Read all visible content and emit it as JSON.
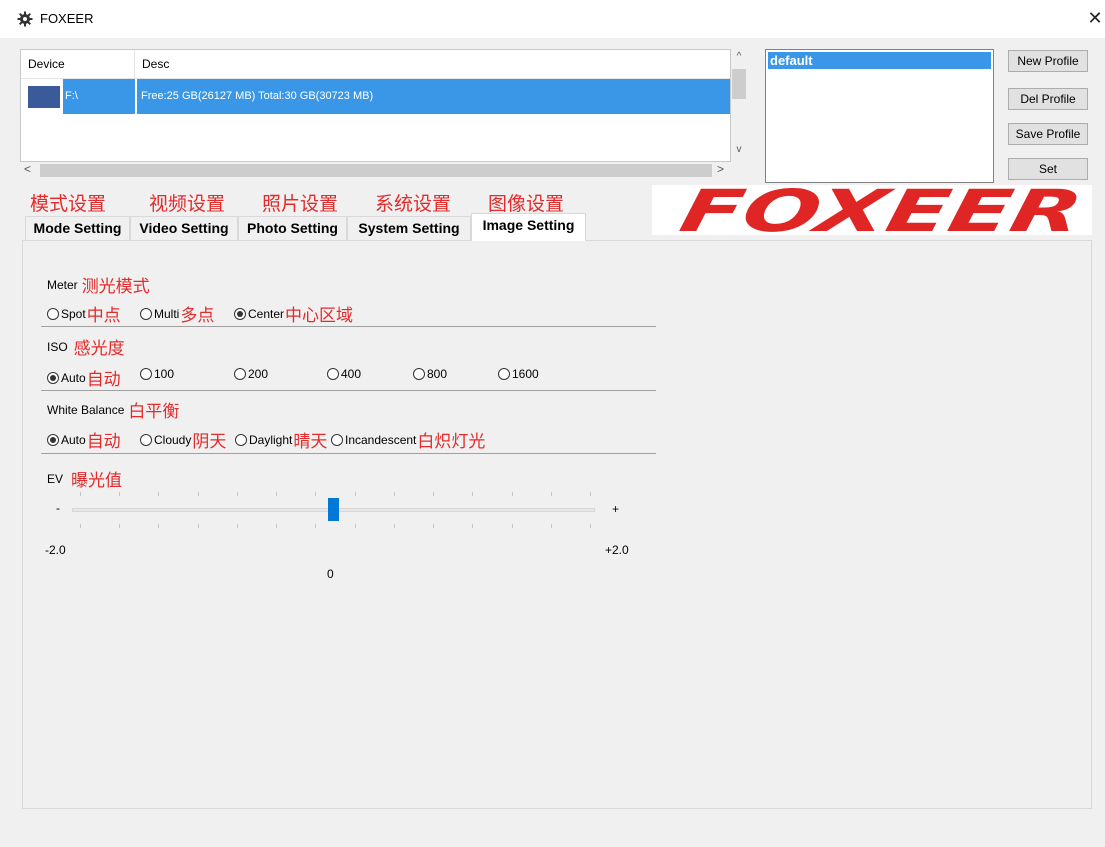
{
  "window": {
    "title": "FOXEER",
    "close_glyph": "✕"
  },
  "device_list": {
    "columns": [
      "Device",
      "Desc"
    ],
    "rows": [
      {
        "device": "F:\\",
        "desc": "Free:25 GB(26127 MB) Total:30 GB(30723 MB)",
        "selected": true
      }
    ]
  },
  "scroll_glyphs": {
    "up": "^",
    "down": "v",
    "left": "<",
    "right": ">"
  },
  "profiles": {
    "items": [
      "default"
    ],
    "selected": "default"
  },
  "buttons": {
    "new": "New Profile",
    "del": "Del Profile",
    "save": "Save Profile",
    "set": "Set"
  },
  "tabs_cn": [
    "模式设置",
    "视频设置",
    "照片设置",
    "系统设置",
    "图像设置"
  ],
  "tabs": [
    "Mode Setting",
    "Video Setting",
    "Photo Setting",
    "System Setting",
    "Image Setting"
  ],
  "active_tab": "Image Setting",
  "logo_text": "FOXEER",
  "image_setting": {
    "meter": {
      "label": "Meter",
      "label_cn": "测光模式",
      "options": [
        {
          "en": "Spot",
          "cn": "中点",
          "selected": false
        },
        {
          "en": "Multi",
          "cn": "多点",
          "selected": false
        },
        {
          "en": "Center",
          "cn": "中心区域",
          "selected": true
        }
      ]
    },
    "iso": {
      "label": "ISO",
      "label_cn": "感光度",
      "options": [
        {
          "en": "Auto",
          "cn": "自动",
          "selected": true
        },
        {
          "en": "100",
          "cn": "",
          "selected": false
        },
        {
          "en": "200",
          "cn": "",
          "selected": false
        },
        {
          "en": "400",
          "cn": "",
          "selected": false
        },
        {
          "en": "800",
          "cn": "",
          "selected": false
        },
        {
          "en": "1600",
          "cn": "",
          "selected": false
        }
      ]
    },
    "white_balance": {
      "label": "White Balance",
      "label_cn": "白平衡",
      "options": [
        {
          "en": "Auto",
          "cn": "自动",
          "selected": true
        },
        {
          "en": "Cloudy",
          "cn": "阴天",
          "selected": false
        },
        {
          "en": "Daylight",
          "cn": "晴天",
          "selected": false
        },
        {
          "en": "Incandescent",
          "cn": "白炽灯光",
          "selected": false
        }
      ]
    },
    "ev": {
      "label": "EV",
      "label_cn": "曝光值",
      "minus": "-",
      "plus": "+",
      "min_label": "-2.0",
      "max_label": "+2.0",
      "value_label": "0",
      "min": -2.0,
      "max": 2.0,
      "value": 0,
      "tick_count": 14
    }
  },
  "colors": {
    "selection": "#3a97e8",
    "accent_red": "#e32b2b",
    "slider_thumb": "#0078d7"
  }
}
